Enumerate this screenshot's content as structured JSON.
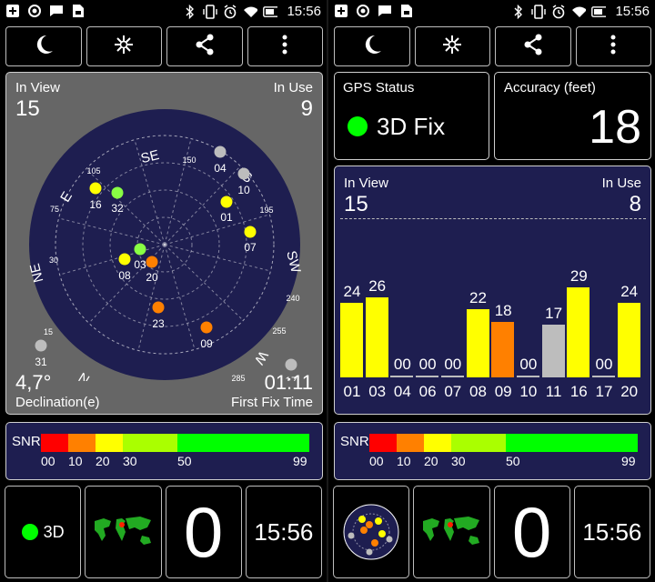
{
  "status_bar": {
    "time": "15:56"
  },
  "toolbar": {
    "icons": [
      "moon-icon",
      "sun-icon",
      "share-icon",
      "more-vert-icon"
    ]
  },
  "sky": {
    "in_view_label": "In View",
    "in_view": "15",
    "in_use_label": "In Use",
    "in_use": "9",
    "declination_value": "4,7°",
    "declination_label": "Declination(e)",
    "first_fix_value": "01:11",
    "first_fix_label": "First Fix Time",
    "cardinals": [
      "SE",
      "S",
      "SW",
      "W",
      "NW",
      "N",
      "NE",
      "E"
    ],
    "degrees": [
      "150",
      "195",
      "240",
      "255",
      "285",
      "300",
      "330",
      "345",
      "15",
      "30",
      "75",
      "105"
    ],
    "satellites": [
      {
        "id": "16",
        "color": "#ffff00"
      },
      {
        "id": "32",
        "color": "#88ff44"
      },
      {
        "id": "01",
        "color": "#ffff00"
      },
      {
        "id": "07",
        "color": "#ffff00"
      },
      {
        "id": "04",
        "color": "#bdbdbd"
      },
      {
        "id": "10",
        "color": "#bdbdbd"
      },
      {
        "id": "08",
        "color": "#ffff00"
      },
      {
        "id": "03",
        "color": "#88ff44"
      },
      {
        "id": "20",
        "color": "#ff8000"
      },
      {
        "id": "23",
        "color": "#ff8000"
      },
      {
        "id": "09",
        "color": "#ff8000"
      },
      {
        "id": "31",
        "color": "#bdbdbd"
      },
      {
        "id": "17",
        "color": "#bdbdbd"
      },
      {
        "id": "06",
        "color": "#bdbdbd"
      },
      {
        "id": "10",
        "color": "#bdbdbd"
      }
    ]
  },
  "snr": {
    "label": "SNR",
    "ticks": [
      "00",
      "10",
      "20",
      "30",
      "50",
      "99"
    ],
    "colors": [
      "#ff0000",
      "#ff8000",
      "#ffff00",
      "#aaff00",
      "#00ff00"
    ]
  },
  "bottom": {
    "fix_badge": "3D",
    "satellites_in_use": "0",
    "clock": "15:56"
  },
  "gps_status": {
    "label": "GPS Status",
    "value": "3D Fix",
    "indicator_color": "#00ff00"
  },
  "accuracy": {
    "label": "Accuracy (feet)",
    "value": "18"
  },
  "signal": {
    "in_view_label": "In View",
    "in_view": "15",
    "in_use_label": "In Use",
    "in_use": "8",
    "bars": [
      {
        "id": "01",
        "snr": "24",
        "color": "#ffff00"
      },
      {
        "id": "03",
        "snr": "26",
        "color": "#ffff00"
      },
      {
        "id": "04",
        "snr": "00",
        "color": "#bdbdbd"
      },
      {
        "id": "06",
        "snr": "00",
        "color": "#bdbdbd"
      },
      {
        "id": "07",
        "snr": "00",
        "color": "#bdbdbd"
      },
      {
        "id": "08",
        "snr": "22",
        "color": "#ffff00"
      },
      {
        "id": "09",
        "snr": "18",
        "color": "#ff8000"
      },
      {
        "id": "10",
        "snr": "00",
        "color": "#bdbdbd"
      },
      {
        "id": "11",
        "snr": "17",
        "color": "#bdbdbd"
      },
      {
        "id": "16",
        "snr": "29",
        "color": "#ffff00"
      },
      {
        "id": "17",
        "snr": "00",
        "color": "#bdbdbd"
      },
      {
        "id": "20",
        "snr": "24",
        "color": "#ffff00"
      }
    ]
  }
}
